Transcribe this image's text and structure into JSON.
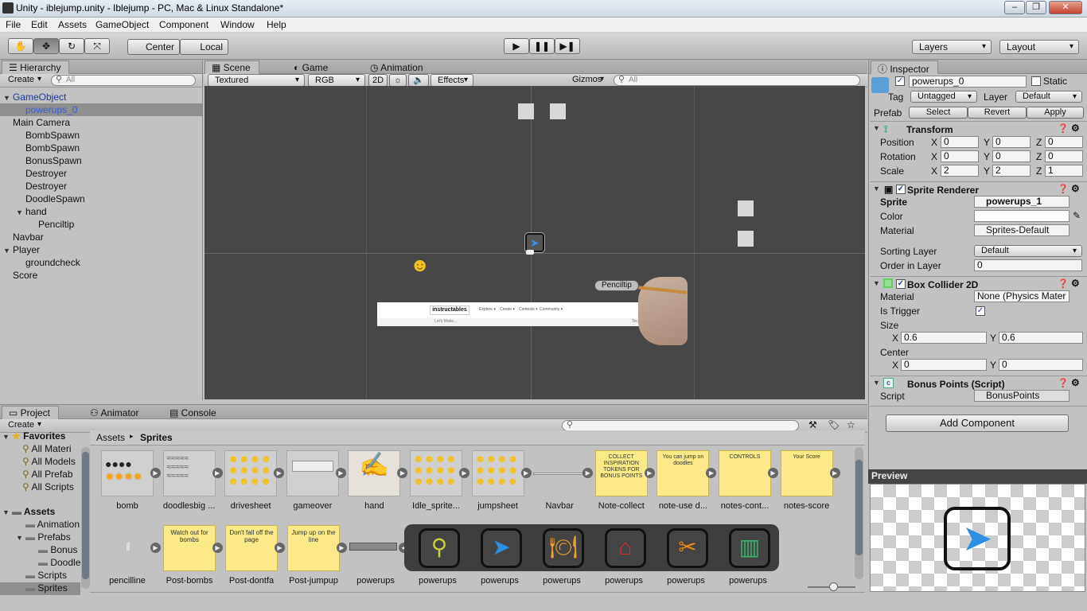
{
  "window": {
    "title": "Unity - iblejump.unity - Iblejump - PC, Mac & Linux Standalone*"
  },
  "menu": [
    "File",
    "Edit",
    "Assets",
    "GameObject",
    "Component",
    "Window",
    "Help"
  ],
  "toolbar": {
    "pivot": "Center",
    "space": "Local",
    "layers": "Layers",
    "layout": "Layout"
  },
  "hierarchy": {
    "tab": "Hierarchy",
    "create": "Create",
    "search_placeholder": "All",
    "items": [
      {
        "label": "GameObject",
        "depth": 0,
        "arrow": "▼"
      },
      {
        "label": "powerups_0",
        "depth": 1,
        "selected": true
      },
      {
        "label": "Main Camera",
        "depth": 0
      },
      {
        "label": "BombSpawn",
        "depth": 1
      },
      {
        "label": "BombSpawn",
        "depth": 1
      },
      {
        "label": "BonusSpawn",
        "depth": 1
      },
      {
        "label": "Destroyer",
        "depth": 1
      },
      {
        "label": "Destroyer",
        "depth": 1
      },
      {
        "label": "DoodleSpawn",
        "depth": 1
      },
      {
        "label": "hand",
        "depth": 1,
        "arrow": "▼"
      },
      {
        "label": "Penciltip",
        "depth": 2
      },
      {
        "label": "Navbar",
        "depth": 0
      },
      {
        "label": "Player",
        "depth": 0,
        "arrow": "▼"
      },
      {
        "label": "groundcheck",
        "depth": 1
      },
      {
        "label": "Score",
        "depth": 0
      }
    ]
  },
  "scene": {
    "tabs": [
      "Scene",
      "Game",
      "Animation"
    ],
    "shading": "Textured",
    "color": "RGB",
    "mode2d": "2D",
    "effects": "Effects",
    "gizmos": "Gizmos",
    "search_placeholder": "All",
    "penciltip_label": "Penciltip",
    "navbar_brand": "instructables",
    "navbar_items": [
      "Explore ▾",
      "Create ▾",
      "Contests ▾",
      "Community ▾"
    ],
    "navbar_sub": "Let's Make...",
    "navbar_right": "Tech Blog"
  },
  "inspector": {
    "tab": "Inspector",
    "object_name": "powerups_0",
    "static": "Static",
    "tag_label": "Tag",
    "tag": "Untagged",
    "layer_label": "Layer",
    "layer": "Default",
    "prefab_label": "Prefab",
    "prefab_buttons": [
      "Select",
      "Revert",
      "Apply"
    ],
    "transform": {
      "title": "Transform",
      "rows": [
        {
          "label": "Position",
          "x": "0",
          "y": "0",
          "z": "0"
        },
        {
          "label": "Rotation",
          "x": "0",
          "y": "0",
          "z": "0"
        },
        {
          "label": "Scale",
          "x": "2",
          "y": "2",
          "z": "1"
        }
      ]
    },
    "sprite_renderer": {
      "title": "Sprite Renderer",
      "sprite_label": "Sprite",
      "sprite": "powerups_1",
      "color_label": "Color",
      "material_label": "Material",
      "material": "Sprites-Default",
      "sorting_label": "Sorting Layer",
      "sorting": "Default",
      "order_label": "Order in Layer",
      "order": "0"
    },
    "box_collider": {
      "title": "Box Collider 2D",
      "material_label": "Material",
      "material": "None (Physics Mater",
      "trigger_label": "Is Trigger",
      "size_label": "Size",
      "size_x": "0.6",
      "size_y": "0.6",
      "center_label": "Center",
      "center_x": "0",
      "center_y": "0"
    },
    "script_comp": {
      "title": "Bonus Points (Script)",
      "script_label": "Script",
      "script": "BonusPoints"
    },
    "add_component": "Add Component",
    "preview": "Preview"
  },
  "project": {
    "tabs": [
      "Project",
      "Animator",
      "Console"
    ],
    "create": "Create",
    "favorites_title": "Favorites",
    "favorites": [
      "All Materi",
      "All Models",
      "All Prefab",
      "All Scripts"
    ],
    "assets_title": "Assets",
    "folders": [
      {
        "label": "Animation",
        "depth": 1
      },
      {
        "label": "Prefabs",
        "depth": 1,
        "arrow": "▼"
      },
      {
        "label": "Bonus",
        "depth": 2
      },
      {
        "label": "Doodle",
        "depth": 2
      },
      {
        "label": "Scripts",
        "depth": 1
      },
      {
        "label": "Sprites",
        "depth": 1,
        "selected": true
      }
    ],
    "breadcrumb": [
      "Assets",
      "Sprites"
    ],
    "row1": [
      "bomb",
      "doodlesbig ...",
      "drivesheet",
      "gameover",
      "hand",
      "Idle_sprite...",
      "jumpsheet",
      "Navbar",
      "Note-collect",
      "note-use d...",
      "notes-cont...",
      "notes-score"
    ],
    "row2": [
      "pencilline",
      "Post-bombs",
      "Post-dontfa",
      "Post-jumpup",
      "powerups",
      "powerups",
      "powerups",
      "powerups",
      "powerups",
      "powerups",
      "powerups"
    ],
    "notes": {
      "collect": "COLLECT INSPIRATION TOKENS FOR BONUS POINTS",
      "use": "You can jump on doodles",
      "controls": "CONTROLS",
      "score": "Your Score",
      "bombs": "Watch out for bombs",
      "dontfall": "Don't fall off the page",
      "jumpup": "Jump up on the line"
    }
  },
  "colors": {
    "selection": "#8f8f8f",
    "scene_bg": "#474747",
    "accent_blue": "#3a8fe0"
  }
}
